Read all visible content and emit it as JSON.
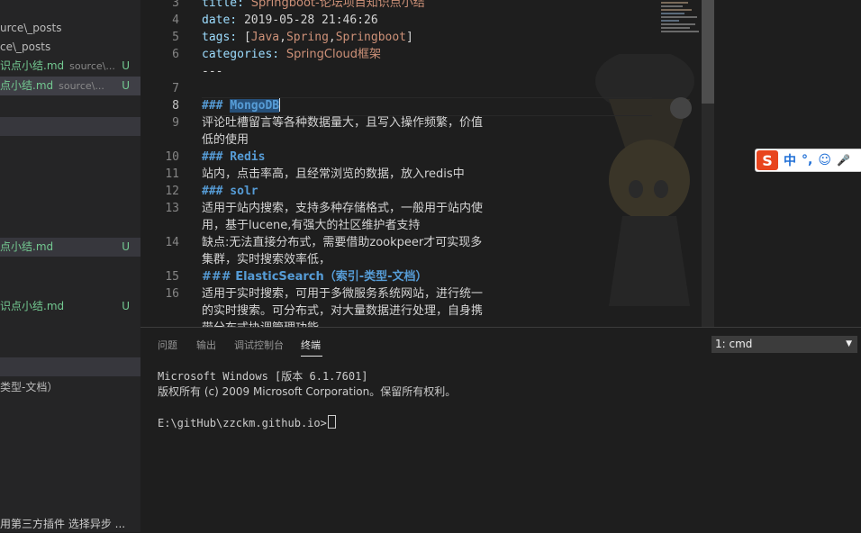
{
  "sidebar": {
    "items": [
      {
        "name": "urce\\_posts",
        "path": "",
        "badge": ""
      },
      {
        "name": "ce\\_posts",
        "path": "",
        "badge": ""
      },
      {
        "name": "识点小结.md",
        "path": "source\\...",
        "badge": "U"
      },
      {
        "name": "点小结.md",
        "path": "source\\...",
        "badge": "U"
      },
      {
        "name": "点小结.md",
        "path": "",
        "badge": "U"
      },
      {
        "name": "识点小结.md",
        "path": "",
        "badge": "U"
      },
      {
        "name": "类型-文档）",
        "path": "",
        "badge": ""
      }
    ],
    "bottom_text": "用第三方插件 选择异步 ..."
  },
  "editor": {
    "line_numbers": [
      "3",
      "4",
      "5",
      "6",
      "7",
      "8",
      "9",
      "10",
      "11",
      "12",
      "13",
      "14",
      "15",
      "16"
    ],
    "lines": {
      "l3_key": "title:",
      "l3_val": "Springboot-论坛项目知识点小结",
      "l4_key": "date:",
      "l4_val": "2019-05-28 21:46:26",
      "l5_key": "tags:",
      "l5_open": "[",
      "l5_t1": "Java",
      "l5_t2": "Spring",
      "l5_t3": "Springboot",
      "l5_close": "]",
      "comma": ",",
      "l6_key": "categories:",
      "l6_val": "SpringCloud框架",
      "l7": "---",
      "l8_hash": "###",
      "l8_word": "MongoDB",
      "l9a": "评论吐槽留言等各种数据量大，且写入操作频繁，价值",
      "l9b": "低的使用",
      "l10": "### Redis",
      "l11": "站内，点击率高，且经常浏览的数据，放入redis中",
      "l12": "### solr",
      "l13a": "适用于站内搜索，支持多种存储格式，一般用于站内使",
      "l13b": "用，基于lucene,有强大的社区维护者支持",
      "l14a": "缺点:无法直接分布式，需要借助zookpeer才可实现多",
      "l14b": "集群，实时搜索效率低，",
      "l15": "### ElasticSearch（索引-类型-文档）",
      "l16a": "适用于实时搜索，可用于多微服务系统网站，进行统一",
      "l16b": "的实时搜索。可分布式，对大量数据进行处理，自身携",
      "l16c": "带分布式协调管理功能"
    }
  },
  "ime": {
    "logo": "S",
    "lang": "中",
    "punct": "°,",
    "emoji": "☺",
    "mic": "🎤"
  },
  "panel": {
    "tabs": [
      "问题",
      "输出",
      "调试控制台",
      "终端"
    ],
    "active_tab": "终端",
    "terminal_select": "1: cmd",
    "terminal_lines": [
      "Microsoft Windows [版本 6.1.7601]",
      "版权所有 (c) 2009 Microsoft Corporation。保留所有权利。",
      "",
      "E:\\gitHub\\zzckm.github.io>"
    ]
  },
  "colors": {
    "accent": "#569cd6",
    "untracked": "#73c991",
    "string": "#ce9178",
    "key": "#9cdcfe"
  }
}
